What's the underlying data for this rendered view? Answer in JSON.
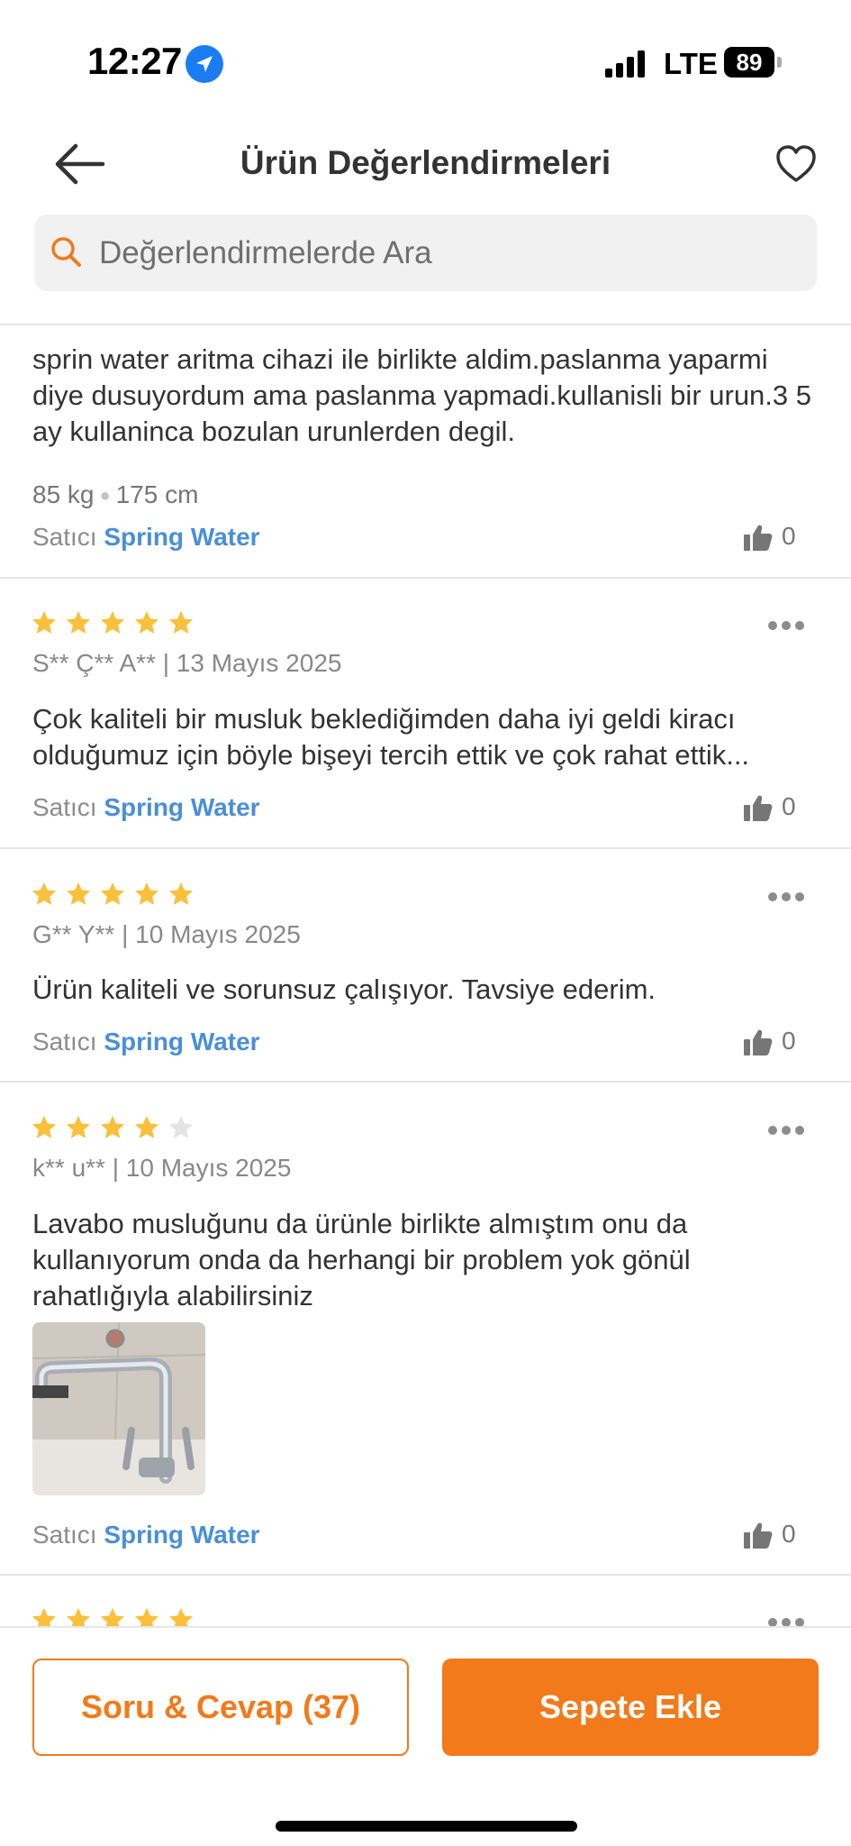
{
  "status_bar": {
    "time": "12:27",
    "network": "LTE",
    "battery": "89"
  },
  "header": {
    "title": "Ürün Değerlendirmeleri"
  },
  "search": {
    "placeholder": "Değerlendirmelerde Ara"
  },
  "colors": {
    "accent": "#f27a1a",
    "seller_link": "#4a8fd7",
    "star_filled": "#f9c03c",
    "star_empty": "#e4e4e4"
  },
  "reviews": [
    {
      "text": "sprin water aritma cihazi ile birlikte aldim.paslanma yaparmi diye dusuyordum ama paslanma yapmadi.kullanisli bir urun.3 5 ay kullaninca bozulan urunlerden degil.",
      "weight": "85 kg",
      "height": "175 cm",
      "seller_label": "Satıcı",
      "seller": "Spring Water",
      "likes": "0"
    },
    {
      "rating": 5,
      "reviewer": "S** Ç** A** | 13 Mayıs 2025",
      "text": "Çok kaliteli bir musluk beklediğimden daha iyi geldi kiracı olduğumuz için böyle bişeyi tercih ettik ve çok rahat ettik...",
      "seller_label": "Satıcı",
      "seller": "Spring Water",
      "likes": "0"
    },
    {
      "rating": 5,
      "reviewer": "G** Y** | 10 Mayıs 2025",
      "text": "Ürün kaliteli ve sorunsuz çalışıyor. Tavsiye ederim.",
      "seller_label": "Satıcı",
      "seller": "Spring Water",
      "likes": "0"
    },
    {
      "rating": 4,
      "reviewer": "k** u** | 10 Mayıs 2025",
      "text": "Lavabo musluğunu da ürünle birlikte almıştım onu da kullanıyorum onda da herhangi bir problem yok gönül rahatlığıyla alabilirsiniz",
      "has_photo": true,
      "seller_label": "Satıcı",
      "seller": "Spring Water",
      "likes": "0"
    },
    {
      "rating": 5
    }
  ],
  "bottom_bar": {
    "qa_button": "Soru & Cevap (37)",
    "cart_button": "Sepete Ekle"
  }
}
